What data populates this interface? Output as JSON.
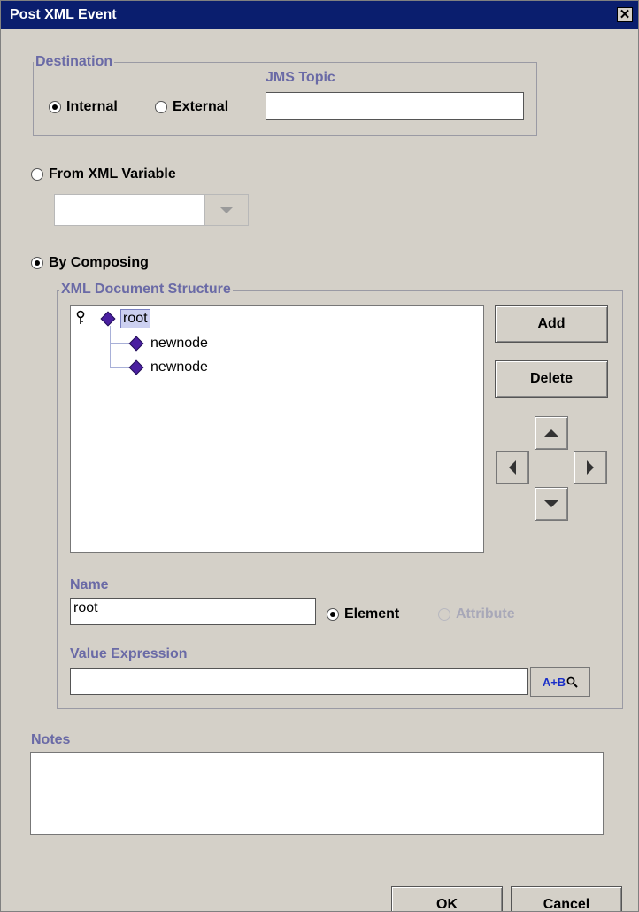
{
  "window": {
    "title": "Post XML Event",
    "close_glyph": "✕"
  },
  "destination": {
    "group_label": "Destination",
    "internal_label": "Internal",
    "external_label": "External",
    "selected": "Internal",
    "jms_topic_label": "JMS Topic",
    "jms_topic_value": ""
  },
  "from_xml_variable": {
    "label": "From XML Variable",
    "selected": false,
    "combo_value": ""
  },
  "by_composing": {
    "label": "By Composing",
    "selected": true
  },
  "xml_structure": {
    "group_label": "XML Document Structure",
    "tree": {
      "root": {
        "label": "root",
        "selected": true
      },
      "children": [
        {
          "label": "newnode"
        },
        {
          "label": "newnode"
        }
      ]
    },
    "add_label": "Add",
    "delete_label": "Delete",
    "name_label": "Name",
    "name_value": "root",
    "element_label": "Element",
    "attribute_label": "Attribute",
    "node_type_selected": "Element",
    "value_expression_label": "Value Expression",
    "value_expression_value": "",
    "expression_builder_label": "A+B"
  },
  "notes": {
    "label": "Notes",
    "value": ""
  },
  "footer": {
    "ok_label": "OK",
    "cancel_label": "Cancel"
  },
  "icons": {
    "tree_handle": "key-icon",
    "node": "diamond-node-icon",
    "expression_builder": "magnifier-icon"
  },
  "colors": {
    "title_bar": "#0a1e6e",
    "label_text": "#6a6aa6",
    "node_diamond": "#4a1fa0",
    "expr_button_text": "#1a2fc8"
  }
}
